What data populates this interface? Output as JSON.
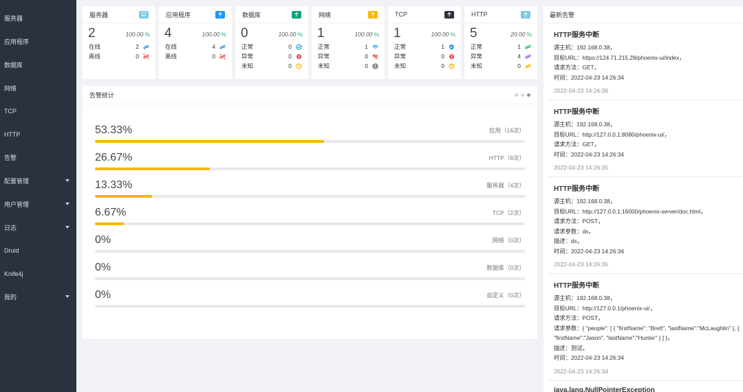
{
  "sidebar": {
    "items": [
      {
        "label": "服务器",
        "has_caret": false
      },
      {
        "label": "应用程序",
        "has_caret": false
      },
      {
        "label": "数据库",
        "has_caret": false
      },
      {
        "label": "网络",
        "has_caret": false
      },
      {
        "label": "TCP",
        "has_caret": false
      },
      {
        "label": "HTTP",
        "has_caret": false
      },
      {
        "label": "告警",
        "has_caret": false
      },
      {
        "label": "配置管理",
        "has_caret": true
      },
      {
        "label": "用户管理",
        "has_caret": true
      },
      {
        "label": "日志",
        "has_caret": true
      },
      {
        "label": "Druid",
        "has_caret": false
      },
      {
        "label": "Knife4j",
        "has_caret": false
      },
      {
        "label": "我的",
        "has_caret": true
      }
    ]
  },
  "cards": [
    {
      "title": "服务器",
      "tag_color": "#7ec8e3",
      "tag_icon": "monitor-icon",
      "count": "2",
      "percent": "100.00",
      "percent_sign": "%",
      "rows": [
        {
          "label": "在线",
          "value": "2",
          "icon": "link-icon",
          "icon_color": "#3a9ad9"
        },
        {
          "label": "离线",
          "value": "0",
          "icon": "broken-link-icon",
          "icon_color": "#e94f4f"
        }
      ]
    },
    {
      "title": "应用程序",
      "tag_color": "#2196f3",
      "tag_icon": "arrow-up-icon",
      "count": "4",
      "percent": "100.00",
      "percent_sign": "%",
      "rows": [
        {
          "label": "在线",
          "value": "4",
          "icon": "link-icon",
          "icon_color": "#3a9ad9"
        },
        {
          "label": "离线",
          "value": "0",
          "icon": "broken-link-icon",
          "icon_color": "#e94f4f"
        }
      ]
    },
    {
      "title": "数据库",
      "tag_color": "#10a37f",
      "tag_icon": "arrow-up-icon",
      "count": "0",
      "percent": "100.00",
      "percent_sign": "%",
      "rows": [
        {
          "label": "正常",
          "value": "0",
          "icon": "check-circle-icon",
          "icon_color": "#2196f3"
        },
        {
          "label": "异常",
          "value": "0",
          "icon": "alert-circle-icon",
          "icon_color": "#e94f4f"
        },
        {
          "label": "未知",
          "value": "0",
          "icon": "clock-icon",
          "icon_color": "#f5b800"
        }
      ]
    },
    {
      "title": "网络",
      "tag_color": "#f5b800",
      "tag_icon": "arrow-up-icon",
      "count": "1",
      "percent": "100.00",
      "percent_sign": "%",
      "rows": [
        {
          "label": "正常",
          "value": "1",
          "icon": "wifi-icon",
          "icon_color": "#2196f3"
        },
        {
          "label": "异常",
          "value": "0",
          "icon": "wifi-off-icon",
          "icon_color": "#e94f4f"
        },
        {
          "label": "未知",
          "value": "0",
          "icon": "globe-icon",
          "icon_color": "#777777"
        }
      ]
    },
    {
      "title": "TCP",
      "tag_color": "#2b323f",
      "tag_icon": "arrow-up-icon",
      "count": "1",
      "percent": "100.00",
      "percent_sign": "%",
      "rows": [
        {
          "label": "正常",
          "value": "1",
          "icon": "shield-icon",
          "icon_color": "#2196f3"
        },
        {
          "label": "异常",
          "value": "0",
          "icon": "alert-circle-icon",
          "icon_color": "#e94f4f"
        },
        {
          "label": "未知",
          "value": "0",
          "icon": "question-circle-icon",
          "icon_color": "#f5b800"
        }
      ]
    },
    {
      "title": "HTTP",
      "tag_color": "#7ec8e3",
      "tag_icon": "arrow-up-icon",
      "count": "5",
      "percent": "20.00",
      "percent_sign": "%",
      "rows": [
        {
          "label": "正常",
          "value": "1",
          "icon": "link-icon",
          "icon_color": "#2bb673"
        },
        {
          "label": "异常",
          "value": "4",
          "icon": "link-icon",
          "icon_color": "#a45de0"
        },
        {
          "label": "未知",
          "value": "0",
          "icon": "link-icon",
          "icon_color": "#f5b800"
        }
      ]
    }
  ],
  "alarm_stats": {
    "title": "告警统计",
    "bar_color": "#f5b800",
    "items": [
      {
        "percent_text": "53.33%",
        "value": 53.33,
        "label": "应用（16次）"
      },
      {
        "percent_text": "26.67%",
        "value": 26.67,
        "label": "HTTP（8次）"
      },
      {
        "percent_text": "13.33%",
        "value": 13.33,
        "label": "服务器（4次）"
      },
      {
        "percent_text": "6.67%",
        "value": 6.67,
        "label": "TCP（2次）"
      },
      {
        "percent_text": "0%",
        "value": 0,
        "label": "网络（0次）"
      },
      {
        "percent_text": "0%",
        "value": 0,
        "label": "数据库（0次）"
      },
      {
        "percent_text": "0%",
        "value": 0,
        "label": "自定义（0次）"
      }
    ]
  },
  "latest_alarms": {
    "title": "最新告警",
    "items": [
      {
        "title": "HTTP服务中断",
        "lines": [
          "源主机：192.168.0.38，",
          "目标URL：https://124.71.215.28/phoenix-ui/index，",
          "请求方法：GET，",
          "时间：2022-04-23 14:26:34"
        ],
        "time": "2022-04-23 14:26:36"
      },
      {
        "title": "HTTP服务中断",
        "lines": [
          "源主机：192.168.0.38，",
          "目标URL：http://127.0.0.1:8080/phoenix-ui/，",
          "请求方法：GET，",
          "时间：2022-04-23 14:26:34"
        ],
        "time": "2022-04-23 14:26:35"
      },
      {
        "title": "HTTP服务中断",
        "lines": [
          "源主机：192.168.0.38，",
          "目标URL：http://127.0.0.1:16000/phoenix-server/doc.html，",
          "请求方法：POST，",
          "请求参数：ds，",
          "描述：ds，",
          "时间：2022-04-23 14:26:34"
        ],
        "time": "2022-04-23 14:26:35"
      },
      {
        "title": "HTTP服务中断",
        "lines": [
          "源主机：192.168.0.38，",
          "目标URL：http://127.0.0.1/phoenix-ui/，",
          "请求方法：POST，",
          "请求参数：{ \"people\": [ { \"firstName\": \"Brett\", \"lastName\":\"McLaughlin\" }, { \"firstName\":\"Jason\", \"lastName\":\"Hunter\" } ] }，",
          "描述：测试，",
          "时间：2022-04-23 14:26:34"
        ],
        "time": "2022-04-23 14:26:34"
      },
      {
        "title": "java.lang.NullPointerException",
        "lines": [],
        "time": ""
      }
    ]
  }
}
